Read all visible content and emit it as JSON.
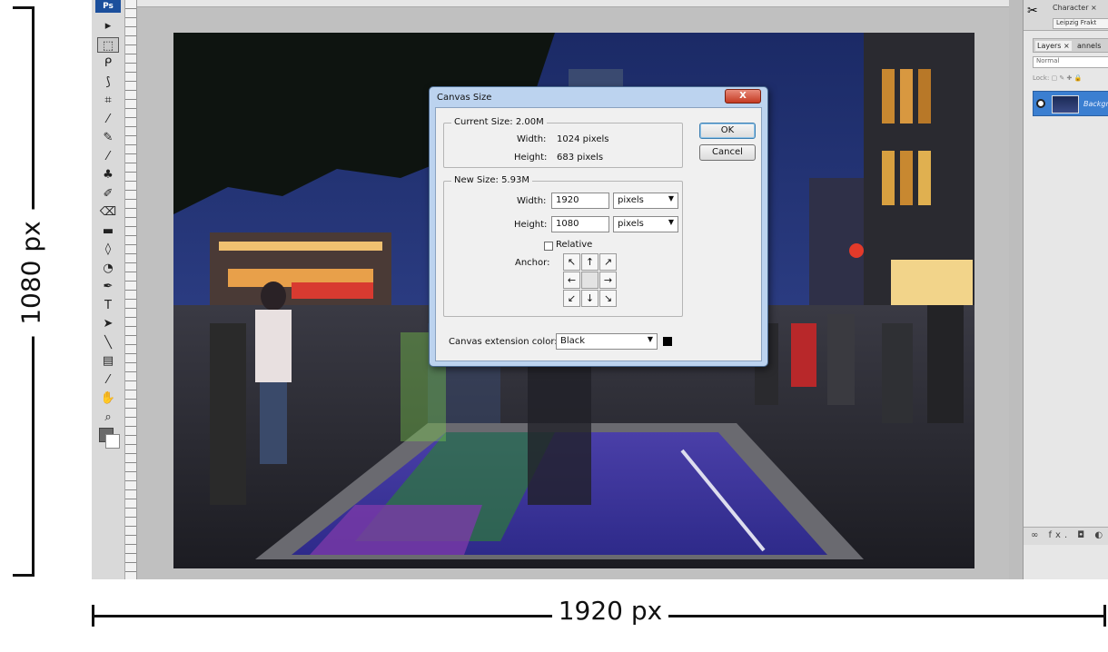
{
  "annotations": {
    "height_label": "1080 px",
    "width_label": "1920 px"
  },
  "toolbox": {
    "logo": "Ps",
    "tools": [
      "move",
      "marquee",
      "lasso",
      "quick-select",
      "crop",
      "eyedropper",
      "healing",
      "brush",
      "clone-stamp",
      "history-brush",
      "eraser",
      "gradient",
      "blur",
      "dodge",
      "pen",
      "type",
      "path-select",
      "line",
      "notes",
      "eyedropper-2",
      "hand",
      "zoom"
    ],
    "tool_glyphs": [
      "▸",
      "⬚",
      "ᑭ",
      "⟆",
      "⌗",
      "⁄",
      "✎",
      "⁄",
      "♣",
      "✐",
      "⌫",
      "▬",
      "◊",
      "◔",
      "✒",
      "T",
      "➤",
      "╲",
      "▤",
      "⁄",
      "✋",
      "⌕"
    ],
    "foreground_color": "#6a6a6a",
    "background_color": "#ffffff"
  },
  "right_panel": {
    "character_tab": "Character ×",
    "font_name": "Leipzig Frakt",
    "layers_tab": "Layers ×",
    "channels_tab": "annels",
    "blend_mode": "Normal",
    "lock_label": "Lock:",
    "layer_name": "Backgr",
    "footer_icons": "∞ fx. ◘ ◐"
  },
  "dialog": {
    "title": "Canvas Size",
    "close": "X",
    "current_size": {
      "legend": "Current Size: 2.00M",
      "width_label": "Width:",
      "width_value": "1024 pixels",
      "height_label": "Height:",
      "height_value": "683 pixels"
    },
    "new_size": {
      "legend": "New Size: 5.93M",
      "width_label": "Width:",
      "width_value": "1920",
      "width_unit": "pixels",
      "height_label": "Height:",
      "height_value": "1080",
      "height_unit": "pixels",
      "relative_label": "Relative",
      "relative_checked": false,
      "anchor_label": "Anchor:",
      "anchor_glyphs": [
        "↖",
        "↑",
        "↗",
        "←",
        "",
        "→",
        "↙",
        "↓",
        "↘"
      ]
    },
    "extension_color_label": "Canvas extension color:",
    "extension_color_value": "Black",
    "extension_swatch": "#000000",
    "ok_label": "OK",
    "cancel_label": "Cancel"
  }
}
